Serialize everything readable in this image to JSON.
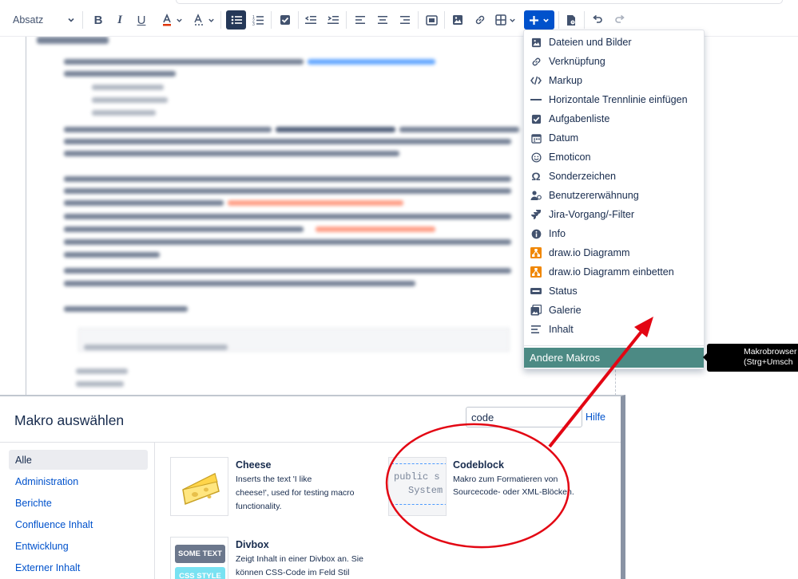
{
  "toolbar": {
    "paragraph_style": "Absatz",
    "buttons": [
      "bold",
      "italic",
      "underline",
      "text-color",
      "formatting",
      "bullet-list",
      "numbered-list",
      "task",
      "outdent",
      "indent",
      "align-left",
      "align-center",
      "align-right",
      "layout",
      "image",
      "link",
      "table",
      "insert",
      "template",
      "undo",
      "redo"
    ]
  },
  "insert_menu": {
    "items": [
      {
        "label": "Dateien und Bilder",
        "icon": "image-icon"
      },
      {
        "label": "Verknüpfung",
        "icon": "link-icon"
      },
      {
        "label": "Markup",
        "icon": "code-icon"
      },
      {
        "label": "Horizontale Trennlinie einfügen",
        "icon": "horizontal-rule-icon"
      },
      {
        "label": "Aufgabenliste",
        "icon": "checkbox-icon"
      },
      {
        "label": "Datum",
        "icon": "calendar-icon"
      },
      {
        "label": "Emoticon",
        "icon": "emoticon-icon"
      },
      {
        "label": "Sonderzeichen",
        "icon": "omega-icon"
      },
      {
        "label": "Benutzererwähnung",
        "icon": "user-mention-icon"
      },
      {
        "label": "Jira-Vorgang/-Filter",
        "icon": "jira-icon"
      },
      {
        "label": "Info",
        "icon": "info-icon"
      },
      {
        "label": "draw.io Diagramm",
        "icon": "drawio-icon"
      },
      {
        "label": "draw.io Diagramm einbetten",
        "icon": "drawio-embed-icon"
      },
      {
        "label": "Status",
        "icon": "status-icon"
      },
      {
        "label": "Galerie",
        "icon": "gallery-icon"
      },
      {
        "label": "Inhalt",
        "icon": "toc-icon"
      }
    ],
    "other_macros": "Andere Makros"
  },
  "tooltip": {
    "line1": "Makrobrowser",
    "line2": "(Strg+Umsch"
  },
  "macro_dialog": {
    "title": "Makro auswählen",
    "search_value": "code",
    "help": "Hilfe",
    "categories": [
      "Alle",
      "Administration",
      "Berichte",
      "Confluence Inhalt",
      "Entwicklung",
      "Externer Inhalt"
    ],
    "macros": [
      {
        "title": "Cheese",
        "desc": [
          "Inserts the text 'I like",
          "cheese!', used for testing macro",
          "functionality."
        ]
      },
      {
        "title": "Codeblock",
        "desc": [
          "Makro zum Formatieren von",
          "Sourcecode- oder XML-Blöcken."
        ],
        "thumb_lines": [
          "public s",
          "System"
        ]
      },
      {
        "title": "Divbox",
        "desc": [
          "Zeigt Inhalt in einer Divbox an. Sie",
          "können CSS-Code im Feld Stil"
        ],
        "thumb_labels": [
          "SOME TEXT",
          "CSS STYLE"
        ]
      }
    ]
  },
  "colors": {
    "accent": "#0052cc",
    "menu_highlight": "#4c8a84",
    "annotation": "#e30613",
    "drawio": "#f08705"
  }
}
